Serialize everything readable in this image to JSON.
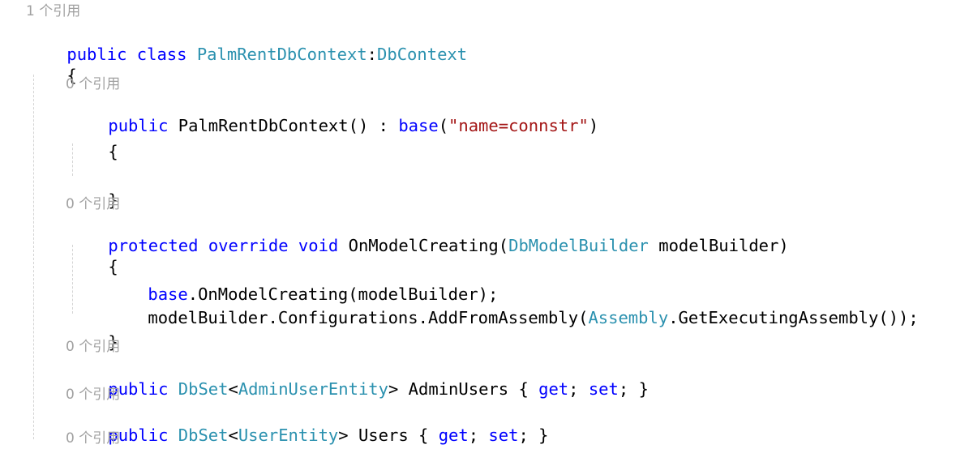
{
  "editor": {
    "language": "csharp",
    "background": "#FFFFFF",
    "colors": {
      "keyword": "#0000FF",
      "type": "#2B91AF",
      "string": "#A31515",
      "plain": "#000000",
      "codelens": "#A0A0A0",
      "indent_guide": "#D4D4D4"
    }
  },
  "codelens": {
    "class_reference": "1 个引用",
    "ctor_reference": "0 个引用",
    "onmodelcreating_reference": "0 个引用",
    "adminusers_reference": "0 个引用",
    "users_reference": "0 个引用",
    "trailing_reference": "0 个引用"
  },
  "code": {
    "line_class_decl": {
      "kw_public": "public",
      "kw_class": "class",
      "type_name": "PalmRentDbContext",
      "colon": ":",
      "base_type": "DbContext"
    },
    "line_class_open_brace": "{",
    "line_ctor": {
      "kw_public": "public",
      "name": "PalmRentDbContext()",
      "colon": ":",
      "kw_base": "base",
      "paren_open": "(",
      "string_literal": "\"name=connstr\"",
      "paren_close": ")"
    },
    "line_ctor_open_brace": "{",
    "line_ctor_close_brace": "}",
    "line_onmodelcreating": {
      "kw_protected": "protected",
      "kw_override": "override",
      "kw_void": "void",
      "name": "OnModelCreating",
      "paren_open": "(",
      "param_type": "DbModelBuilder",
      "param_name": "modelBuilder",
      "paren_close": ")"
    },
    "line_method_open_brace": "{",
    "line_base_call": {
      "kw_base": "base",
      "rest": ".OnModelCreating(modelBuilder);"
    },
    "line_addfromassembly": {
      "prefix": "modelBuilder.Configurations.AddFromAssembly(",
      "type_assembly": "Assembly",
      "suffix": ".GetExecutingAssembly());"
    },
    "line_method_close_brace": "}",
    "line_adminusers": {
      "kw_public": "public",
      "type_dbset": "DbSet",
      "angle_open": "<",
      "type_generic": "AdminUserEntity",
      "angle_close": ">",
      "prop_name": "AdminUsers",
      "brace_open": "{",
      "kw_get": "get",
      "semi1": ";",
      "kw_set": "set",
      "semi2": ";",
      "brace_close": "}"
    },
    "line_users": {
      "kw_public": "public",
      "type_dbset": "DbSet",
      "angle_open": "<",
      "type_generic": "UserEntity",
      "angle_close": ">",
      "prop_name": "Users",
      "brace_open": "{",
      "kw_get": "get",
      "semi1": ";",
      "kw_set": "set",
      "semi2": ";",
      "brace_close": "}"
    }
  }
}
